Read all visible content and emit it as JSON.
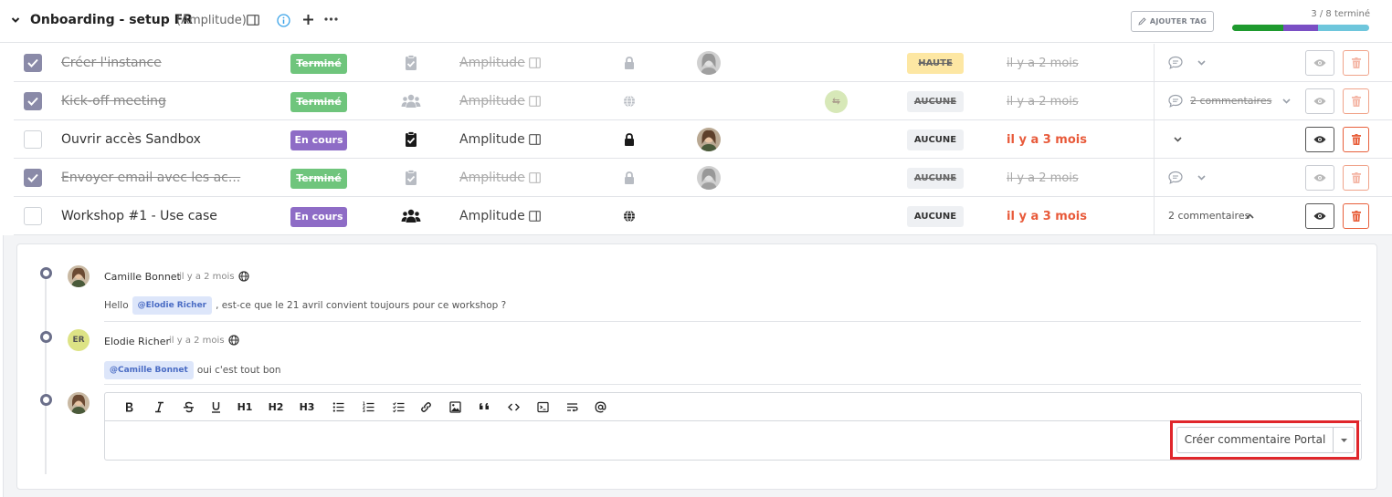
{
  "header": {
    "title": "Onboarding - setup FR",
    "project": "(Amplitude)",
    "add_tag_label": "AJOUTER TAG",
    "progress_text": "3 / 8 terminé",
    "progress": [
      {
        "fraction": 0.375,
        "color": "#1e9a2e"
      },
      {
        "fraction": 0.25,
        "color": "#7a4fc4"
      },
      {
        "fraction": 0.375,
        "color": "#6ec6dc"
      }
    ]
  },
  "colors": {
    "done_green": "#6fc57c",
    "in_progress_purple": "#8e6cc6",
    "date_red": "#e85a3a",
    "highlight_red": "#e0262b"
  },
  "tasks": [
    {
      "name": "Créer l'instance",
      "done": true,
      "status": "Terminé",
      "status_color": "green",
      "type_icon": "clipboard-check-icon",
      "project": "Amplitude",
      "visibility": "lock-icon",
      "has_avatar": true,
      "link_badge": "",
      "priority": "HAUTE",
      "priority_color": "yellow",
      "date": "il y a 2 mois",
      "comment_icon": true,
      "comments": "",
      "comments_open": false
    },
    {
      "name": "Kick-off meeting",
      "done": true,
      "status": "Terminé",
      "status_color": "green",
      "type_icon": "users-icon",
      "project": "Amplitude",
      "visibility": "globe-icon",
      "has_avatar": false,
      "link_badge": "⇆",
      "priority": "AUCUNE",
      "priority_color": "grey",
      "date": "il y a 2 mois",
      "comment_icon": true,
      "comments": "2 commentaires",
      "comments_open": false
    },
    {
      "name": "Ouvrir accès Sandbox",
      "done": false,
      "status": "En cours",
      "status_color": "purple",
      "type_icon": "clipboard-check-icon",
      "project": "Amplitude",
      "visibility": "lock-icon",
      "has_avatar": true,
      "link_badge": "",
      "priority": "AUCUNE",
      "priority_color": "grey",
      "date": "il y a 3 mois",
      "comment_icon": false,
      "comments": "",
      "comments_open": false
    },
    {
      "name": "Envoyer email avec les ac...",
      "done": true,
      "status": "Terminé",
      "status_color": "green",
      "type_icon": "clipboard-check-icon",
      "project": "Amplitude",
      "visibility": "lock-icon",
      "has_avatar": true,
      "link_badge": "",
      "priority": "AUCUNE",
      "priority_color": "grey",
      "date": "il y a 2 mois",
      "comment_icon": true,
      "comments": "",
      "comments_open": false
    },
    {
      "name": "Workshop #1 - Use case",
      "done": false,
      "status": "En cours",
      "status_color": "purple",
      "type_icon": "users-icon",
      "project": "Amplitude",
      "visibility": "globe-icon",
      "has_avatar": false,
      "link_badge": "",
      "priority": "AUCUNE",
      "priority_color": "grey",
      "date": "il y a 3 mois",
      "comment_icon": false,
      "comments": "2 commentaires",
      "comments_open": true
    }
  ],
  "comments": [
    {
      "author": "Camille Bonnet",
      "time": "il y a 2 mois",
      "initials": "",
      "before": "Hello",
      "mention": "@Elodie Richer",
      "after": ", est-ce que le 21 avril convient toujours pour ce workshop ?"
    },
    {
      "author": "Elodie Richer",
      "time": "il y a 2 mois",
      "initials": "ER",
      "before": "",
      "mention": "@Camille Bonnet",
      "after": "oui c'est tout bon"
    }
  ],
  "editor": {
    "toolbar": [
      "bold-icon",
      "italic-icon",
      "strikethrough-icon",
      "underline-icon",
      "H1",
      "H2",
      "H3",
      "bullet-list-icon",
      "ordered-list-icon",
      "checklist-icon",
      "link-icon",
      "image-icon",
      "quote-icon",
      "code-icon",
      "code-block-icon",
      "wrap-icon",
      "mention-icon"
    ],
    "submit_label": "Créer commentaire Portal"
  }
}
